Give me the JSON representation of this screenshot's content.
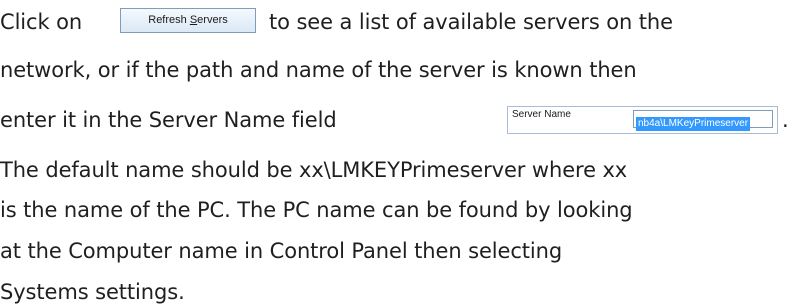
{
  "paragraph": {
    "line1_pre": "Click on",
    "line1_post": "to see a list of available servers on the",
    "line2": "network, or if the path and name of the server is known then",
    "line3_pre": "enter it in the Server Name field",
    "line3_post": ".",
    "line4": "The default name should be xx\\LMKEYPrimeserver where xx",
    "line5": "is the name of the PC. The PC name can be found by looking",
    "line6": "at the Computer name in Control Panel then selecting",
    "line7": "Systems settings."
  },
  "refresh_button": {
    "label_pre": "Refresh ",
    "label_underlined": "S",
    "label_post": "ervers"
  },
  "server_field": {
    "label": "Server Name",
    "value": "nb4a\\LMKeyPrimeserver"
  }
}
